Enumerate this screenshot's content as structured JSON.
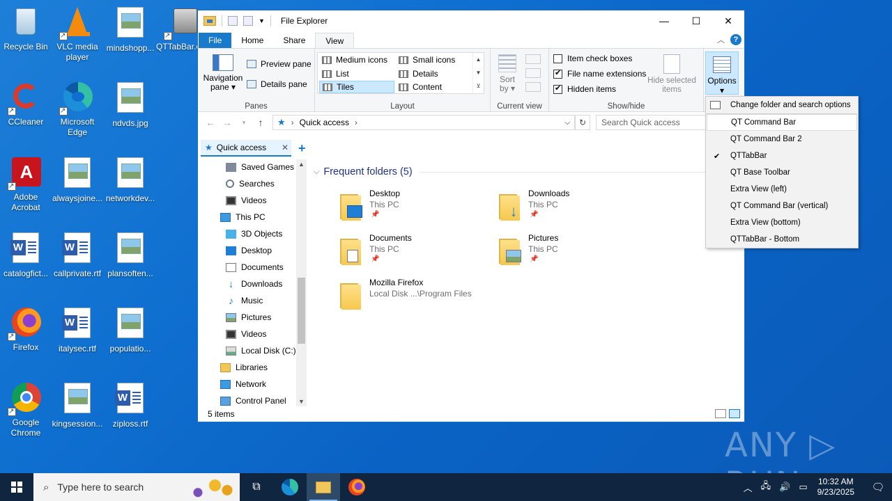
{
  "desktop": {
    "icons": [
      {
        "label": "Recycle Bin"
      },
      {
        "label": "VLC media player"
      },
      {
        "label": "mindshopp..."
      },
      {
        "label": "QTTabBar.e..."
      },
      {
        "label": "CCleaner"
      },
      {
        "label": "Microsoft Edge"
      },
      {
        "label": "ndvds.jpg"
      },
      {
        "label": "Adobe Acrobat"
      },
      {
        "label": "alwaysjoine..."
      },
      {
        "label": "networkdev..."
      },
      {
        "label": "catalogfict..."
      },
      {
        "label": "callprivate.rtf"
      },
      {
        "label": "plansoften..."
      },
      {
        "label": "Firefox"
      },
      {
        "label": "italysec.rtf"
      },
      {
        "label": "populatio..."
      },
      {
        "label": "Google Chrome"
      },
      {
        "label": "kingsession..."
      },
      {
        "label": "ziploss.rtf"
      }
    ]
  },
  "window": {
    "title": "File Explorer",
    "controls": {
      "minimize": "—",
      "maximize": "☐",
      "close": "✕"
    },
    "tabs": [
      "File",
      "Home",
      "Share",
      "View"
    ],
    "ribbon": {
      "panes": {
        "group_label": "Panes",
        "navigation_pane": "Navigation pane ▾",
        "preview_pane": "Preview pane",
        "details_pane": "Details pane"
      },
      "layout": {
        "group_label": "Layout",
        "items": [
          "Medium icons",
          "Small icons",
          "List",
          "Details",
          "Tiles",
          "Content"
        ],
        "selected": "Tiles"
      },
      "current_view": {
        "group_label": "Current view",
        "sort_by": "Sort by ▾"
      },
      "show_hide": {
        "group_label": "Show/hide",
        "item_check_boxes": "Item check boxes",
        "file_name_extensions": "File name extensions",
        "hidden_items": "Hidden items",
        "hide_selected_items": "Hide selected items",
        "checked": {
          "item_check_boxes": false,
          "file_name_extensions": true,
          "hidden_items": true
        }
      },
      "options": {
        "label": "Options ▾"
      }
    },
    "address": {
      "path": "Quick access",
      "search_placeholder": "Search Quick access"
    },
    "nav_pane": {
      "tab": "Quick access",
      "items": [
        "Saved Games",
        "Searches",
        "Videos",
        "This PC",
        "3D Objects",
        "Desktop",
        "Documents",
        "Downloads",
        "Music",
        "Pictures",
        "Videos",
        "Local Disk (C:)",
        "Libraries",
        "Network",
        "Control Panel"
      ]
    },
    "content": {
      "section_header": "Frequent folders (5)",
      "folders": [
        {
          "name": "Desktop",
          "location": "This PC"
        },
        {
          "name": "Downloads",
          "location": "This PC"
        },
        {
          "name": "Documents",
          "location": "This PC"
        },
        {
          "name": "Pictures",
          "location": "This PC"
        },
        {
          "name": "Mozilla Firefox",
          "location": "Local Disk ...\\Program Files"
        }
      ]
    },
    "status": {
      "item_count": "5 items"
    }
  },
  "options_menu": {
    "items": [
      "Change folder and search options",
      "QT Command Bar",
      "QT Command Bar 2",
      "QTTabBar",
      "QT Base Toolbar",
      "Extra View (left)",
      "QT Command Bar (vertical)",
      "Extra View (bottom)",
      "QTTabBar - Bottom"
    ],
    "checked": "QTTabBar",
    "highlighted": "QT Command Bar"
  },
  "watermark": "ANY ▷ RUN",
  "taskbar": {
    "search_placeholder": "Type here to search",
    "time": "10:32 AM",
    "date": "9/23/2025"
  },
  "colors": {
    "accent": "#1979ca",
    "desktop_bg": "#0f6fd0",
    "taskbar_bg": "#10253f",
    "section_header": "#1e3287"
  }
}
